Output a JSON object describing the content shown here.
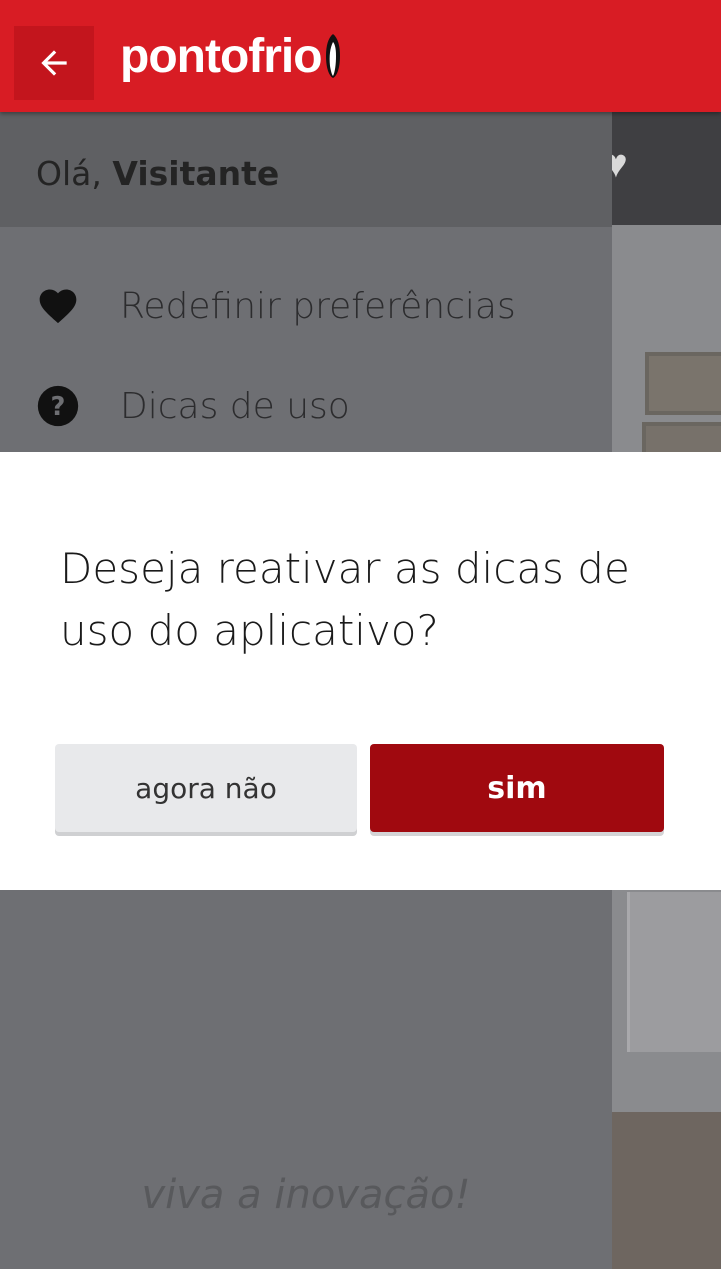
{
  "appbar": {
    "brand": "pontofrio",
    "back_icon": "arrow-left-icon",
    "color": "#d81c24"
  },
  "drawer": {
    "greeting_prefix": "Olá,",
    "greeting_name": "Visitante",
    "items": [
      {
        "label": "Redefinir preferências",
        "icon": "heart-icon"
      },
      {
        "label": "Dicas de uso",
        "icon": "help-circle-icon"
      }
    ],
    "tagline": "viva a inovação!"
  },
  "dialog": {
    "message": "Deseja reativar as dicas de uso do aplicativo?",
    "cancel_label": "agora não",
    "confirm_label": "sim",
    "confirm_color": "#a0090f"
  }
}
